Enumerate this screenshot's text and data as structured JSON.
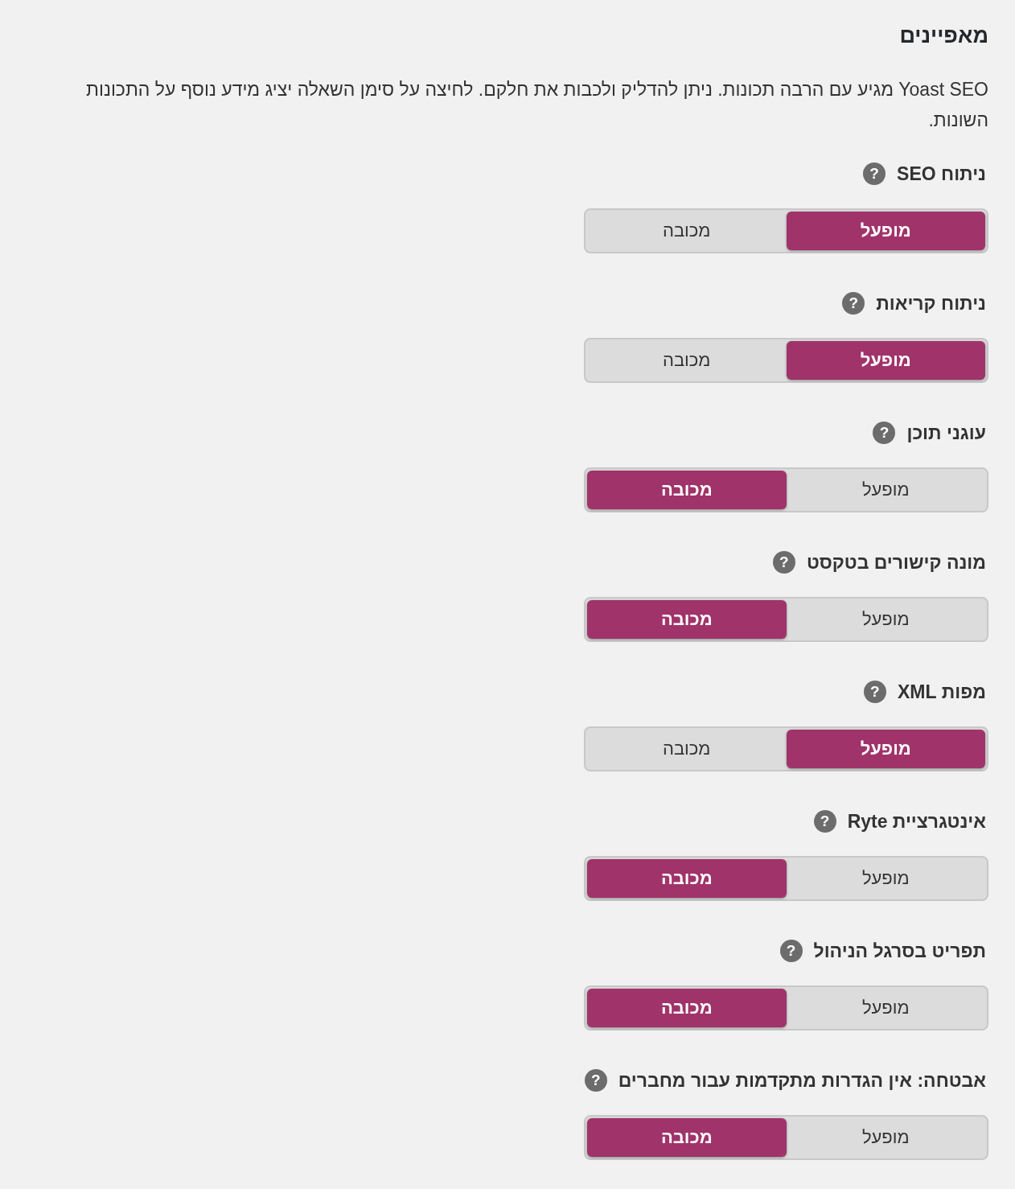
{
  "title": "מאפיינים",
  "description": "Yoast SEO מגיע עם הרבה תכונות. ניתן להדליק ולכבות את חלקם. לחיצה על סימן השאלה יציג מידע נוסף על התכונות השונות.",
  "features": [
    {
      "label": "ניתוח SEO",
      "help": "?",
      "options": [
        {
          "label": "מופעל",
          "selected": true
        },
        {
          "label": "מכובה",
          "selected": false
        }
      ]
    },
    {
      "label": "ניתוח קריאות",
      "help": "?",
      "options": [
        {
          "label": "מופעל",
          "selected": true
        },
        {
          "label": "מכובה",
          "selected": false
        }
      ]
    },
    {
      "label": "עוגני תוכן",
      "help": "?",
      "options": [
        {
          "label": "מופעל",
          "selected": false
        },
        {
          "label": "מכובה",
          "selected": true
        }
      ]
    },
    {
      "label": "מונה קישורים בטקסט",
      "help": "?",
      "options": [
        {
          "label": "מופעל",
          "selected": false
        },
        {
          "label": "מכובה",
          "selected": true
        }
      ]
    },
    {
      "label": "מפות XML",
      "help": "?",
      "options": [
        {
          "label": "מופעל",
          "selected": true
        },
        {
          "label": "מכובה",
          "selected": false
        }
      ]
    },
    {
      "label": "אינטגרציית Ryte",
      "help": "?",
      "options": [
        {
          "label": "מופעל",
          "selected": false
        },
        {
          "label": "מכובה",
          "selected": true
        }
      ]
    },
    {
      "label": "תפריט בסרגל הניהול",
      "help": "?",
      "options": [
        {
          "label": "מופעל",
          "selected": false
        },
        {
          "label": "מכובה",
          "selected": true
        }
      ]
    },
    {
      "label": "אבטחה: אין הגדרות מתקדמות עבור מחברים",
      "help": "?",
      "options": [
        {
          "label": "מופעל",
          "selected": false
        },
        {
          "label": "מכובה",
          "selected": true
        }
      ]
    }
  ]
}
